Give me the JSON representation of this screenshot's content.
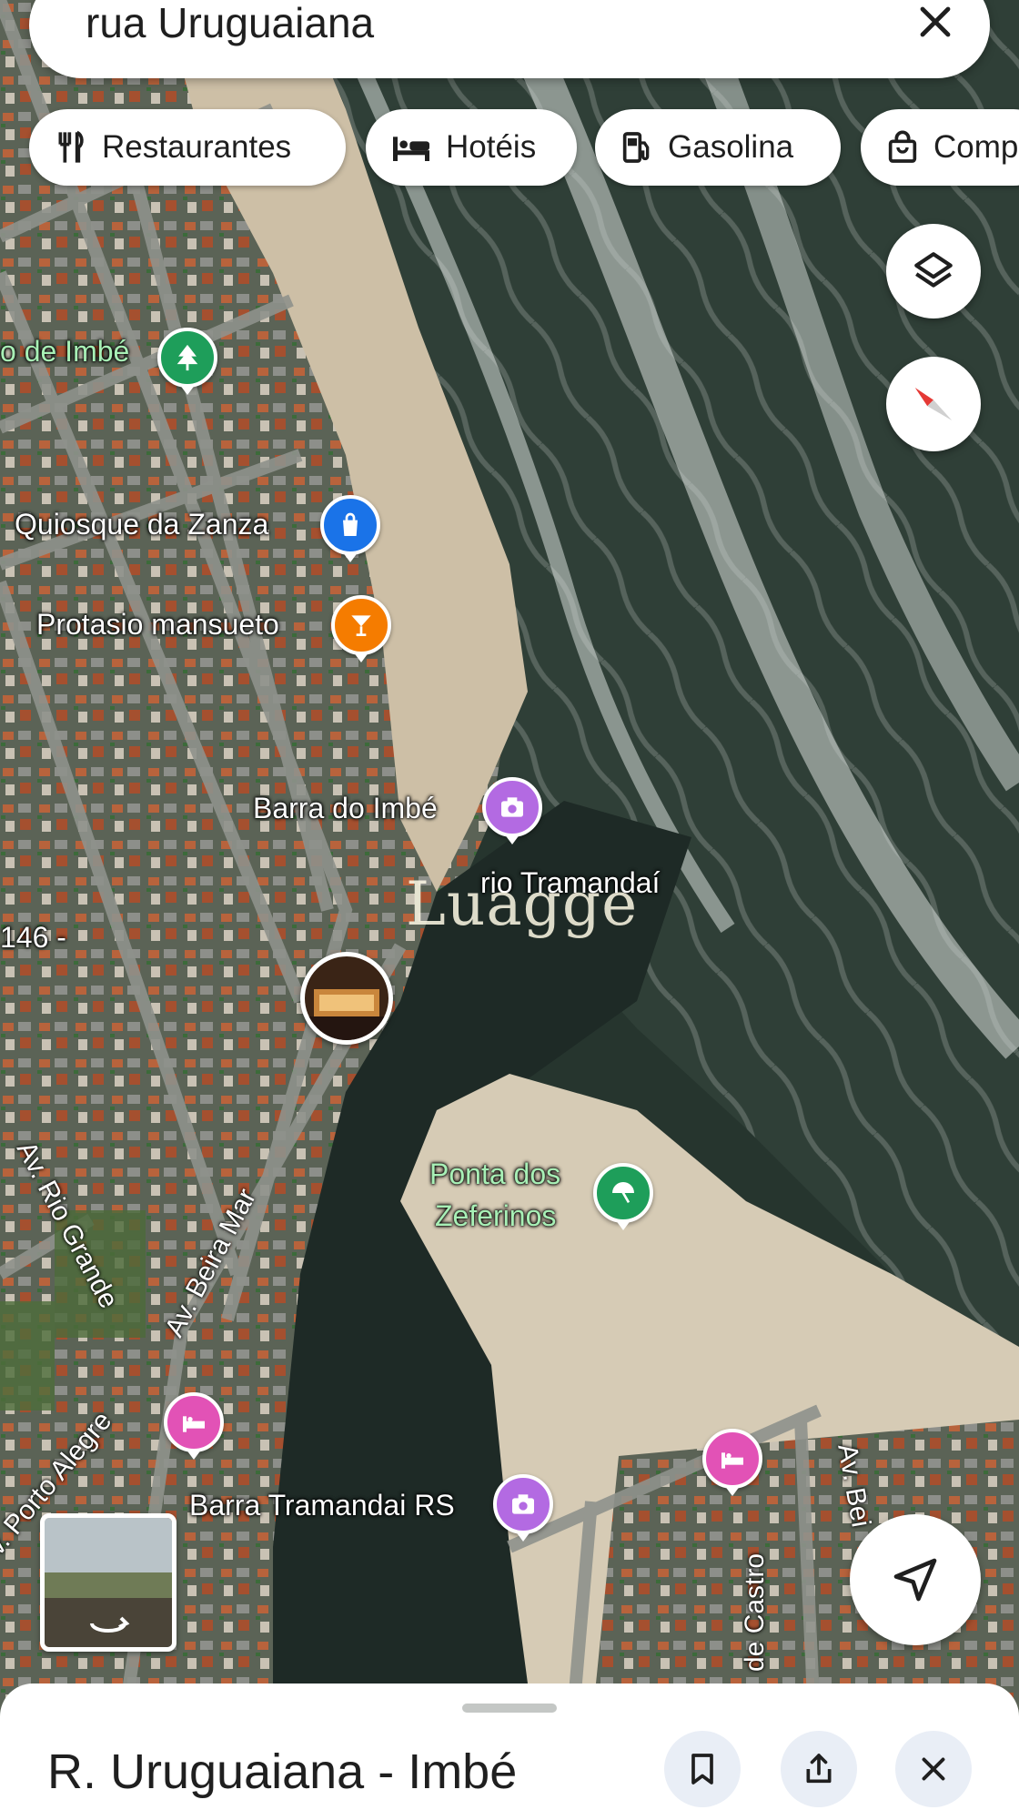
{
  "search": {
    "query": "rua Uruguaiana"
  },
  "chips": [
    {
      "label": "Restaurantes",
      "icon": "restaurant-icon"
    },
    {
      "label": "Hotéis",
      "icon": "hotel-icon"
    },
    {
      "label": "Gasolina",
      "icon": "gas-station-icon"
    },
    {
      "label": "Comp",
      "icon": "shopping-bag-icon"
    }
  ],
  "map_labels": {
    "park": "o de Imbé",
    "kiosk": "Quiosque da Zanza",
    "bar": "Protasio mansueto",
    "barra_imbe": "Barra do Imbé",
    "river": "rio Tramandaí",
    "road_146": "146 -",
    "ponta_line1": "Ponta dos",
    "ponta_line2": "Zeferinos",
    "barra_tramandai": "Barra Tramandai RS"
  },
  "road_labels": {
    "rio_grande": "Av. Rio Grande",
    "beira_mar": "Av. Beira Mar",
    "porto_alegre": "v. Porto Alegre",
    "castro": "de Castro",
    "av_bei": "Av. Bei"
  },
  "watermark": "Luagge",
  "bottom_sheet": {
    "title": "R. Uruguaiana - Imbé"
  },
  "colors": {
    "park_pin": "#1e9e5a",
    "shop_pin": "#1a73e8",
    "bar_pin": "#f57c00",
    "photo_pin": "#b36ae2",
    "hotel_pin": "#e252b6",
    "beach_pin": "#1e9e5a",
    "compass_red": "#e53935"
  }
}
